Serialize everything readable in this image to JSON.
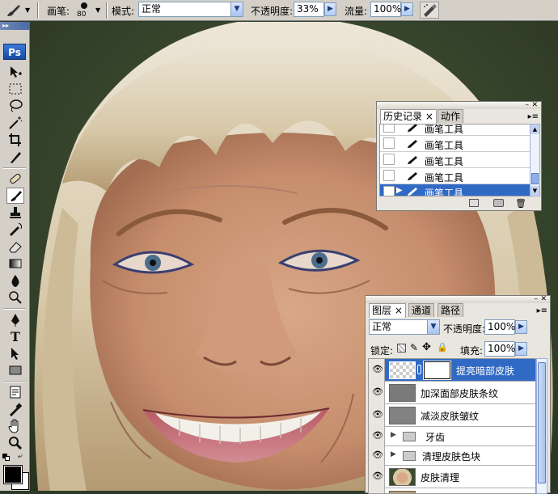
{
  "options_bar": {
    "brush_label": "画笔:",
    "brush_size": "80",
    "mode_label": "模式:",
    "mode_value": "正常",
    "opacity_label": "不透明度:",
    "opacity_value": "33%",
    "flow_label": "流量:",
    "flow_value": "100%"
  },
  "toolbox": {
    "logo": "Ps"
  },
  "history_panel": {
    "tabs": [
      {
        "label": "历史记录 ×"
      },
      {
        "label": "动作"
      }
    ],
    "items": [
      {
        "label": "画笔工具"
      },
      {
        "label": "画笔工具"
      },
      {
        "label": "画笔工具"
      },
      {
        "label": "画笔工具"
      },
      {
        "label": "画笔工具"
      }
    ]
  },
  "layers_panel": {
    "tabs": [
      {
        "label": "图层 ×"
      },
      {
        "label": "通道"
      },
      {
        "label": "路径"
      }
    ],
    "blend_mode": "正常",
    "opacity_label": "不透明度:",
    "opacity_value": "100%",
    "lock_label": "锁定:",
    "fill_label": "填充:",
    "fill_value": "100%",
    "layers": [
      {
        "name": "提亮暗部皮肤",
        "type": "masked",
        "selected": true
      },
      {
        "name": "加深面部皮肤条纹",
        "type": "gray"
      },
      {
        "name": "减淡皮肤皱纹",
        "type": "gray"
      },
      {
        "name": "牙齿",
        "type": "group"
      },
      {
        "name": "清理皮肤色块",
        "type": "group"
      },
      {
        "name": "皮肤清理",
        "type": "photo"
      }
    ]
  },
  "colors": {
    "chrome": "#d4d0c8",
    "selection": "#316ac5",
    "panel_bg": "#e8e6df"
  }
}
